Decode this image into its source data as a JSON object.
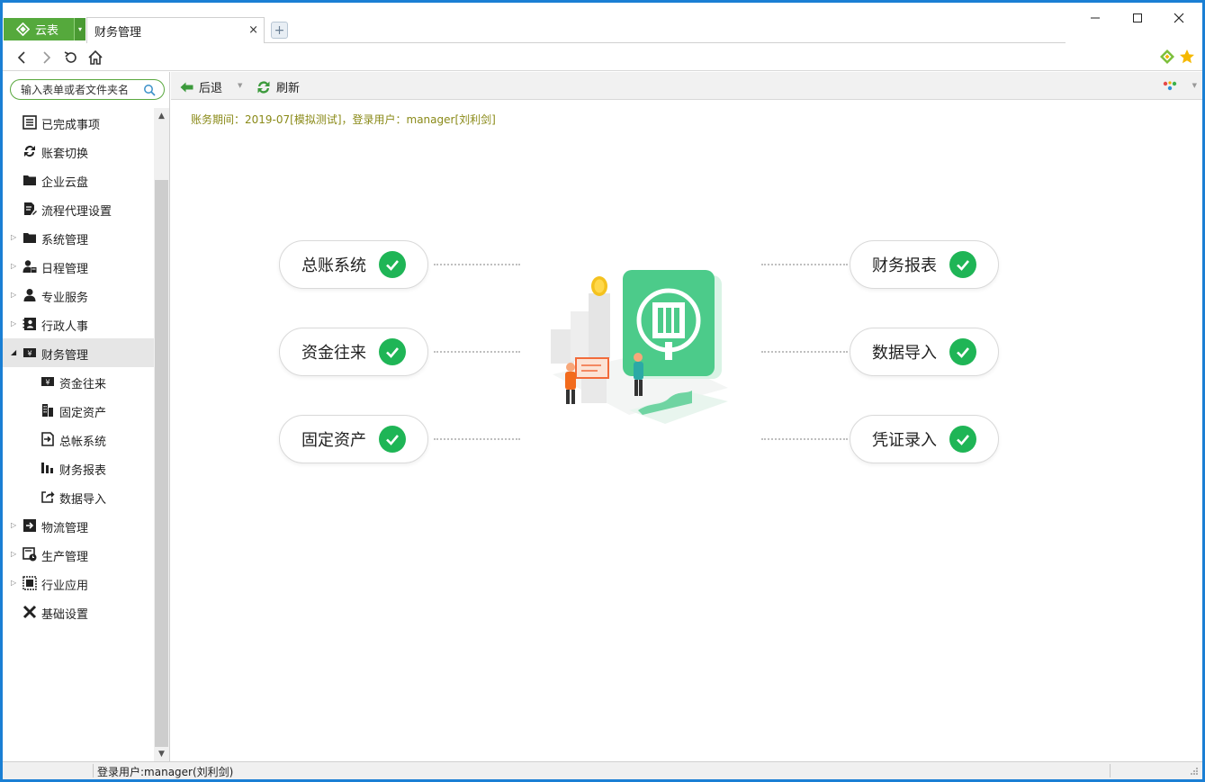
{
  "app": {
    "brand_label": "云表",
    "active_tab": "财务管理",
    "tab_close": "×",
    "tab_add": "+"
  },
  "window_controls": {
    "minimize": "—",
    "maximize": "☐",
    "close": "✕"
  },
  "sidebar": {
    "search_placeholder": "输入表单或者文件夹名",
    "items": [
      {
        "label": "已完成事项",
        "icon": "list-icon",
        "expandable": false
      },
      {
        "label": "账套切换",
        "icon": "refresh-icon",
        "expandable": false
      },
      {
        "label": "企业云盘",
        "icon": "folder-icon",
        "expandable": false
      },
      {
        "label": "流程代理设置",
        "icon": "document-edit-icon",
        "expandable": false
      },
      {
        "label": "系统管理",
        "icon": "folder-icon",
        "expandable": true
      },
      {
        "label": "日程管理",
        "icon": "user-calendar-icon",
        "expandable": true
      },
      {
        "label": "专业服务",
        "icon": "user-icon",
        "expandable": true
      },
      {
        "label": "行政人事",
        "icon": "contact-card-icon",
        "expandable": true
      },
      {
        "label": "财务管理",
        "icon": "money-icon",
        "expandable": true,
        "expanded": true,
        "selected": true
      },
      {
        "label": "资金往来",
        "icon": "money-icon",
        "sub": true
      },
      {
        "label": "固定资产",
        "icon": "building-icon",
        "sub": true
      },
      {
        "label": "总帐系统",
        "icon": "ledger-import-icon",
        "sub": true
      },
      {
        "label": "财务报表",
        "icon": "bar-chart-icon",
        "sub": true
      },
      {
        "label": "数据导入",
        "icon": "export-icon",
        "sub": true
      },
      {
        "label": "物流管理",
        "icon": "logistics-icon",
        "expandable": true
      },
      {
        "label": "生产管理",
        "icon": "production-icon",
        "expandable": true
      },
      {
        "label": "行业应用",
        "icon": "grid-icon",
        "expandable": true
      },
      {
        "label": "基础设置",
        "icon": "tools-icon",
        "expandable": false
      }
    ]
  },
  "toolbar": {
    "back_label": "后退",
    "refresh_label": "刷新"
  },
  "content": {
    "period_text": "账务期间：2019-07[模拟测试]，登录用户：manager[刘利剑]",
    "left_modules": [
      "总账系统",
      "资金往来",
      "固定资产"
    ],
    "right_modules": [
      "财务报表",
      "数据导入",
      "凭证录入"
    ]
  },
  "status": {
    "user_text": "登录用户:manager(刘利剑)"
  },
  "colors": {
    "accent_green": "#55a93c",
    "check_green": "#1fb556",
    "period_text": "#8a8a18"
  }
}
